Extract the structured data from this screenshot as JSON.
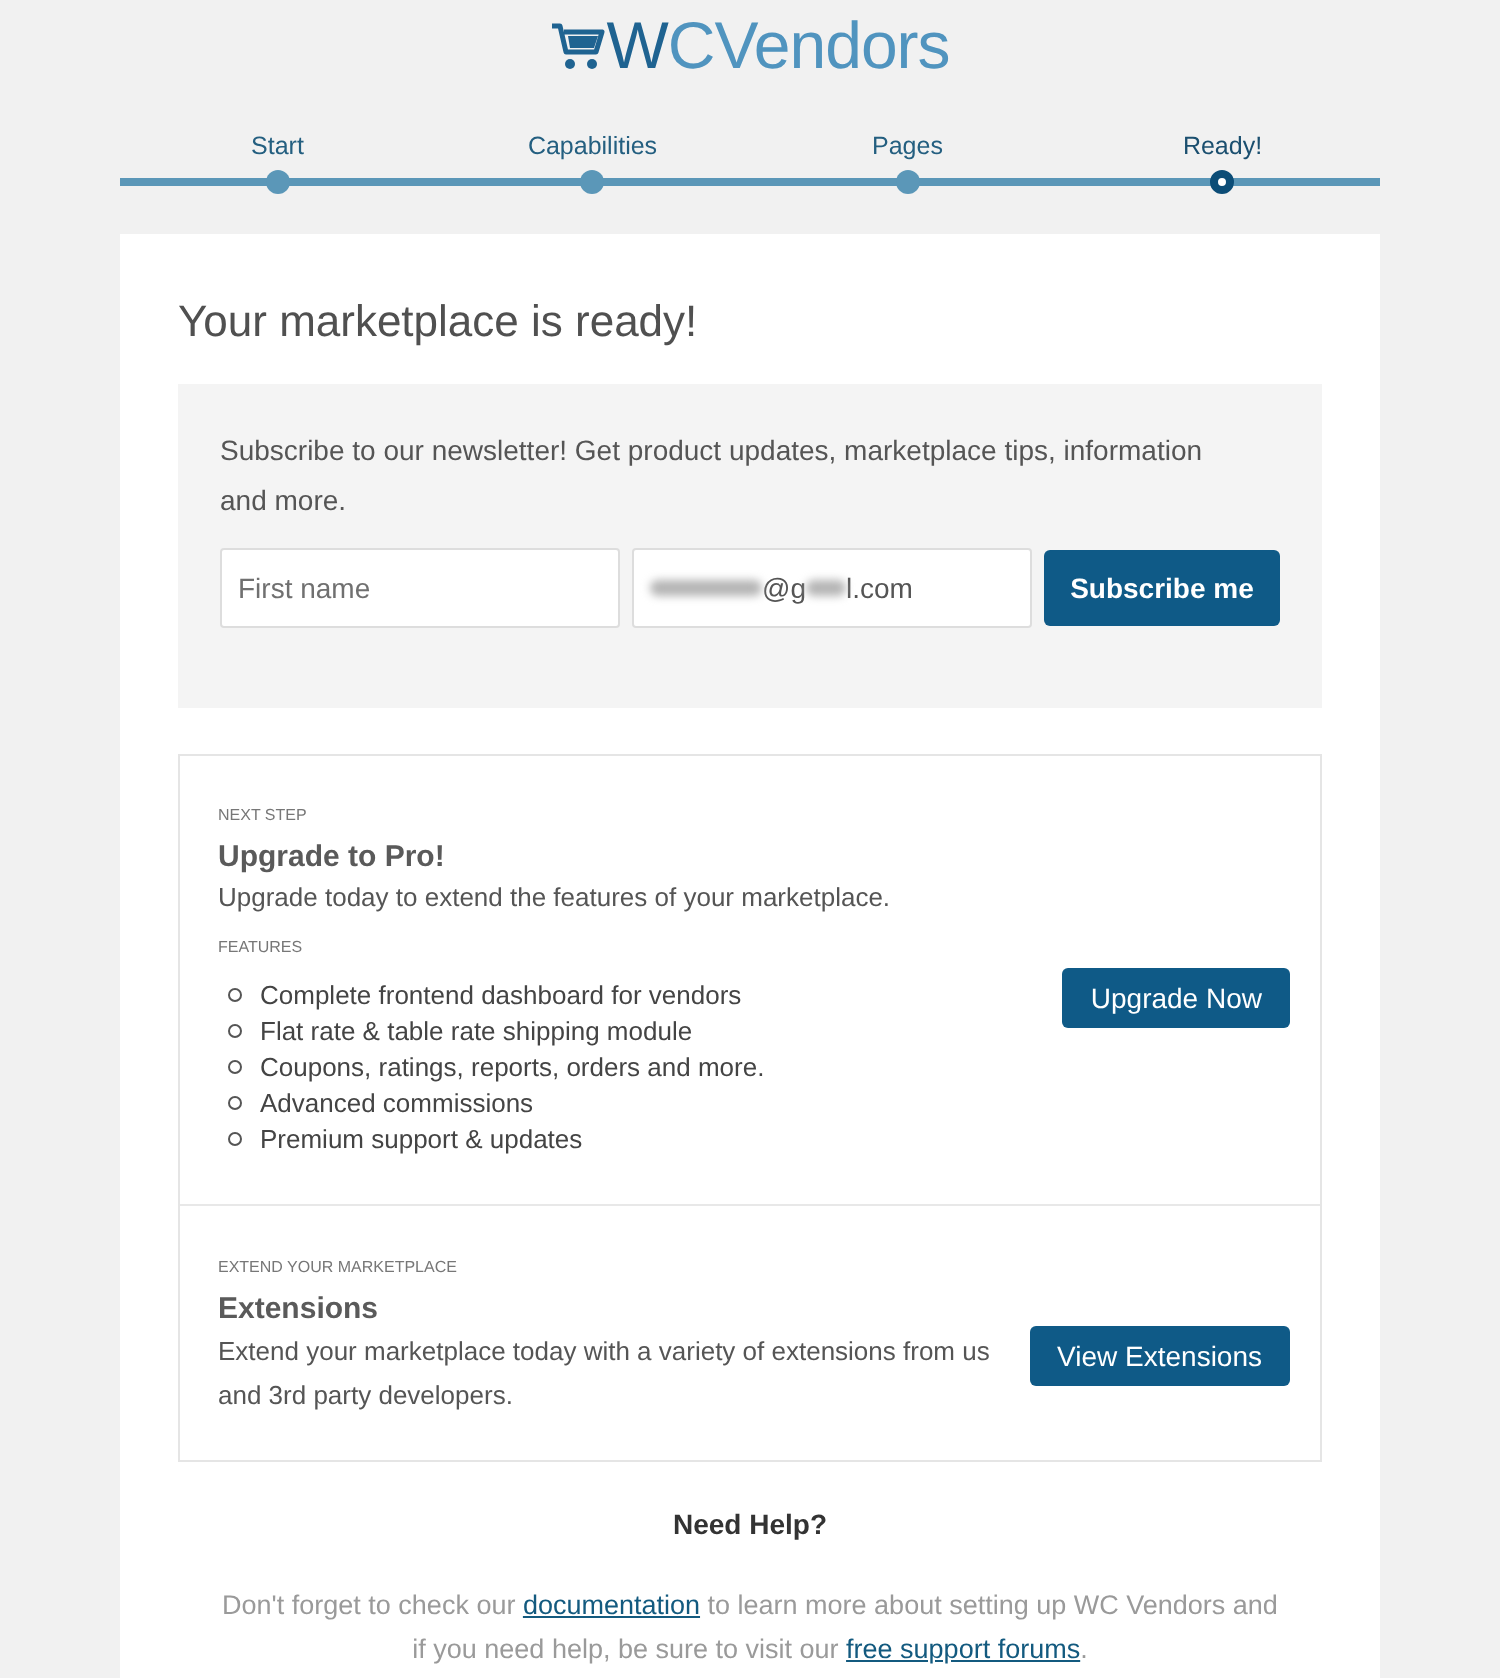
{
  "logo": {
    "text": "WCVendors"
  },
  "steps": [
    {
      "label": "Start",
      "selected": false
    },
    {
      "label": "Capabilities",
      "selected": false
    },
    {
      "label": "Pages",
      "selected": false
    },
    {
      "label": "Ready!",
      "selected": true
    }
  ],
  "title": "Your marketplace is ready!",
  "newsletter": {
    "text": "Subscribe to our newsletter! Get product updates, marketplace tips, information and more.",
    "first_name": {
      "placeholder": "First name"
    },
    "email": {
      "value_parts": [
        {
          "kind": "redacted",
          "wide": true
        },
        {
          "kind": "text",
          "text": "@g"
        },
        {
          "kind": "redacted",
          "wide": false
        },
        {
          "kind": "text",
          "text": "l.com"
        }
      ]
    },
    "button": "Subscribe me"
  },
  "sections": [
    {
      "eyebrow": "NEXT STEP",
      "heading": "Upgrade to Pro!",
      "description": "Upgrade today to extend the features of your marketplace.",
      "list_label": "FEATURES",
      "features": [
        "Complete frontend dashboard for vendors",
        "Flat rate & table rate shipping module",
        "Coupons, ratings, reports, orders and more.",
        "Advanced commissions",
        "Premium support & updates"
      ],
      "button": "Upgrade Now"
    },
    {
      "eyebrow": "EXTEND YOUR MARKETPLACE",
      "heading": "Extensions",
      "description": "Extend your marketplace today with a variety of extensions from us and 3rd party developers.",
      "button": "View Extensions"
    }
  ],
  "help": {
    "heading": "Need Help?",
    "parts": [
      {
        "kind": "text",
        "text": "Don't forget to check our "
      },
      {
        "kind": "link",
        "text": "documentation"
      },
      {
        "kind": "text",
        "text": " to learn more about setting up WC Vendors and if you need help, be sure to visit our "
      },
      {
        "kind": "link",
        "text": "free support forums"
      },
      {
        "kind": "text",
        "text": "."
      }
    ]
  }
}
